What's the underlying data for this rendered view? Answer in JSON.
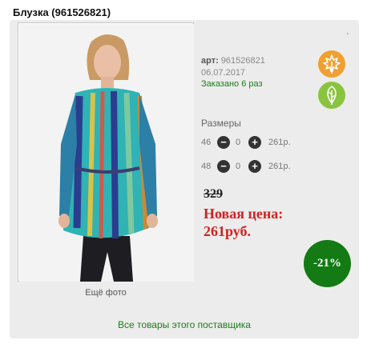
{
  "product": {
    "title": "Блузка (961526821)",
    "apostrophe": "'",
    "article_label": "арт:",
    "article_value": "961526821",
    "date": "06.07.2017",
    "ordered": "Заказано 6 раз",
    "more_photos": "Ещё фото"
  },
  "sizes": {
    "title": "Размеры",
    "rows": [
      {
        "size": "46",
        "qty": "0",
        "price": "261р."
      },
      {
        "size": "48",
        "qty": "0",
        "price": "261р."
      }
    ],
    "minus": "−",
    "plus": "+"
  },
  "pricing": {
    "old_price": "329",
    "new_price_label": "Новая цена:",
    "new_price_value": "261руб.",
    "discount": "-21%"
  },
  "footer": {
    "supplier_link": "Все товары этого поставщика"
  },
  "badges": {
    "orange_icon": "autumn-leaf-icon",
    "green_icon": "leaf-icon"
  },
  "colors": {
    "accent_green": "#1a7d1a",
    "price_red": "#d42020",
    "discount_bg": "#147a14"
  }
}
